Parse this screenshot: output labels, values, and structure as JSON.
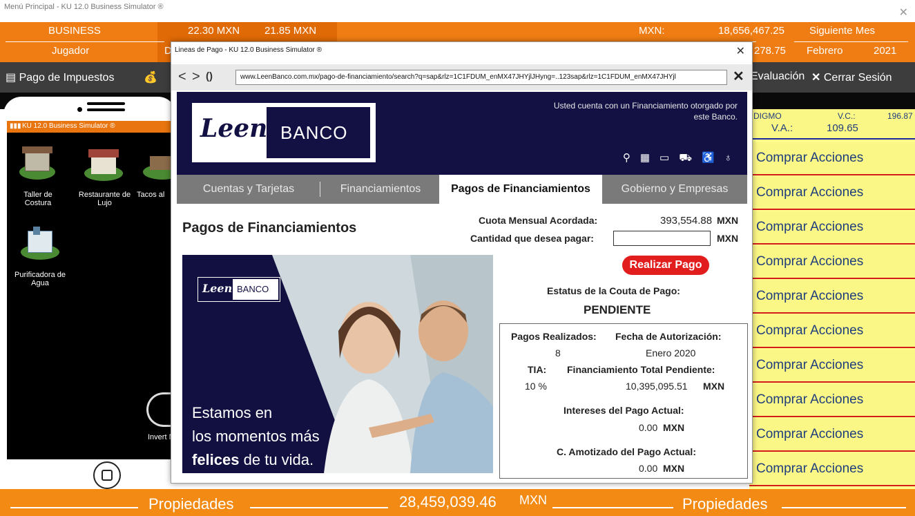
{
  "window": {
    "title": "Menú Principal - KU 12.0 Business Simulator ®"
  },
  "header": {
    "row1": {
      "business": "BUSINESS",
      "rate1": "22.30 MXN",
      "rate2": "21.85 MXN",
      "mxn_label": "MXN:",
      "balance": "18,656,467.25",
      "next_month": "Siguiente Mes"
    },
    "row2": {
      "player": "Jugador",
      "dollar_partial": "Dolar",
      "value_partial": "278.75",
      "month": "Febrero",
      "year": "2021"
    }
  },
  "toolbar": {
    "tax_payment": "Pago de Impuestos",
    "evaluation": "Evaluación",
    "logout": "Cerrar Sesión"
  },
  "phone": {
    "status_title": "KU 12.0 Business Simulator ®",
    "apps": [
      {
        "label": "Taller de Costura"
      },
      {
        "label": "Restaurante de Lujo"
      },
      {
        "label": "Tacos al"
      },
      {
        "label": "Purificadora de Agua"
      }
    ],
    "invest_partial": "Invert Nego"
  },
  "stock": {
    "ticker": "DIGMO",
    "vc_label": "V.C.:",
    "vc_value": "196.87",
    "va_label": "V.A.:",
    "va_value": "109.65",
    "buy_label": "Comprar Acciones"
  },
  "footer": {
    "left": "Propiedades",
    "value": "28,459,039.46",
    "currency": "MXN",
    "right": "Propiedades"
  },
  "dialog": {
    "title": "Lineas de Pago - KU 12.0 Business Simulator ®",
    "url": "www.LeenBanco.com.mx/pago-de-financiamiento/search?q=sap&rlz=1C1FDUM_enMX47JHYjlJHyng=..123sap&rlz=1C1FDUM_enMX47JHYjl",
    "bank": {
      "logo_script": "Leen",
      "logo_word": "BANCO",
      "notice": "Usted cuenta con un Financiamiento otorgado por este Banco."
    },
    "nav": [
      "Cuentas y Tarjetas",
      "Financiamientos",
      "Pagos de Financiamientos",
      "Gobierno y Empresas"
    ],
    "page_title": "Pagos de Financiamientos",
    "cuota_label": "Cuota Mensual Acordada:",
    "cuota_value": "393,554.88",
    "currency": "MXN",
    "pay_label": "Cantidad que desea pagar:",
    "pay_value": "",
    "pay_button": "Realizar Pago",
    "status_label": "Estatus de la Couta de Pago:",
    "status_value": "PENDIENTE",
    "details": {
      "payments_label": "Pagos Realizados:",
      "payments_value": "8",
      "auth_label": "Fecha de Autorización:",
      "auth_value": "Enero 2020",
      "tia_label": "TIA:",
      "tia_value": "10 %",
      "total_label": "Financiamiento Total Pendiente:",
      "total_value": "10,395,095.51",
      "interest_label": "Intereses del Pago Actual:",
      "interest_value": "0.00",
      "amort_label": "C. Amotizado del Pago Actual:",
      "amort_value": "0.00"
    },
    "ad": {
      "line1": "Estamos en",
      "line2": "los momentos más",
      "line3_bold": "felices",
      "line3_rest": "de tu vida."
    }
  },
  "colors": {
    "orange": "#ef7d13",
    "navy": "#131144",
    "red": "#e21d1d",
    "yellow": "#fbf786"
  }
}
